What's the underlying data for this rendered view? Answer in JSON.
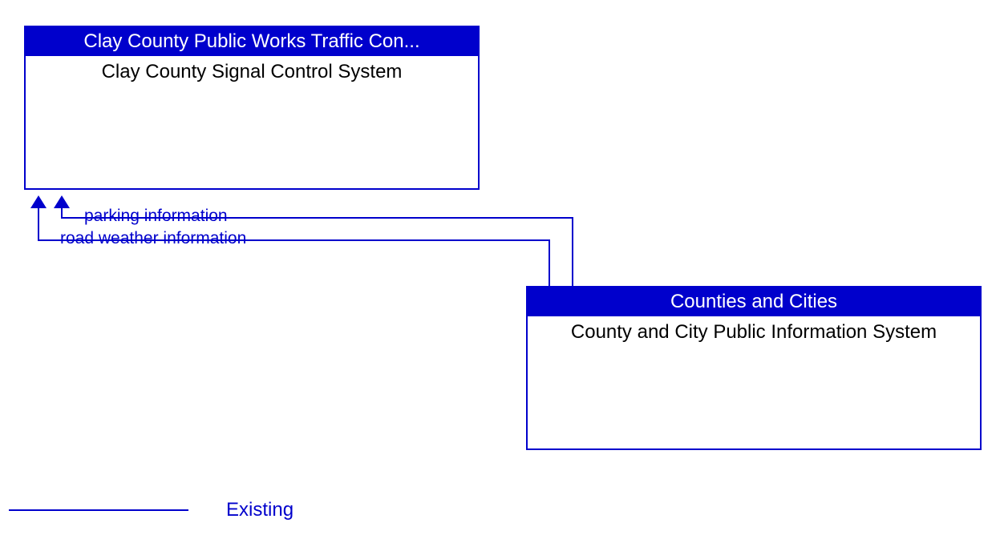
{
  "nodes": {
    "top": {
      "header": "Clay County Public Works Traffic Con...",
      "body": "Clay County Signal Control System"
    },
    "bottom": {
      "header": "Counties and Cities",
      "body": "County and City Public Information System"
    }
  },
  "flows": {
    "parking": "parking information",
    "weather": "road weather information"
  },
  "legend": {
    "existing": "Existing"
  }
}
